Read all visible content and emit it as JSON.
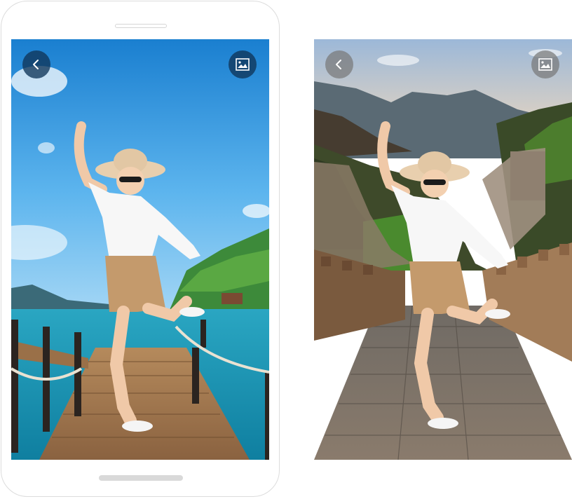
{
  "app": {
    "preview_left": {
      "background_scene": "tropical-beach-pier",
      "back_icon": "chevron-left-icon",
      "gallery_icon": "image-gallery-icon"
    },
    "preview_right": {
      "background_scene": "great-wall-stone-path",
      "back_icon": "chevron-left-icon",
      "gallery_icon": "image-gallery-icon"
    },
    "colors": {
      "button_left": "#103458",
      "button_right": "#7a7a7a",
      "sky_blue": "#2f8fd8",
      "sea_teal": "#1f9fb4"
    }
  }
}
